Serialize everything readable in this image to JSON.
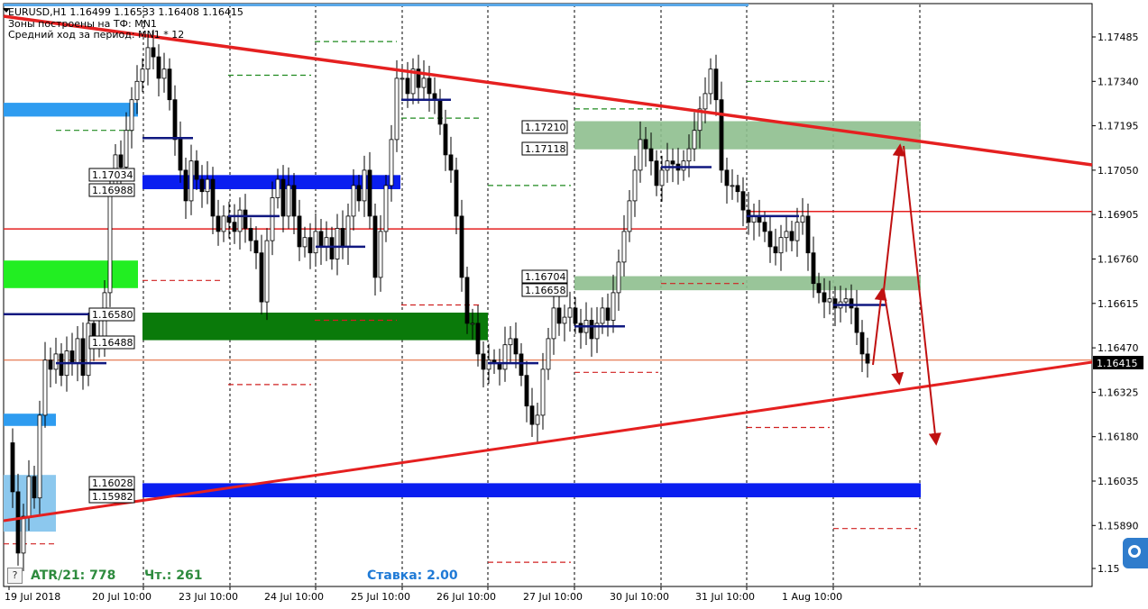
{
  "header": {
    "symbol_line": "EURUSD,H1  1.16499 1.16533 1.16408 1.16415",
    "zones_line": "Зоны построены на ТФ: MN1",
    "avg_line": "Средний ход за период: MN1 * 12"
  },
  "footer": {
    "atr": "ATR/21: 778",
    "count": "Чт.: 261",
    "rate": "Ставка: 2.00",
    "help": "?"
  },
  "colors": {
    "trendline": "#e52020",
    "level_blue": "#0a1ef0",
    "level_lightblue": "#2e9cf0",
    "zone_green_bright": "#22ee22",
    "zone_green_dark": "#0a7a0a",
    "zone_green_pale": "#8ebf8e",
    "pivot_navy": "#101880",
    "arrow": "#c01010"
  },
  "chart_data": {
    "type": "candlestick",
    "symbol": "EURUSD",
    "timeframe": "H1",
    "ohlc_last": {
      "open": 1.16499,
      "high": 1.16533,
      "low": 1.16408,
      "close": 1.16415
    },
    "current_price": "1.16415",
    "ylim": [
      1.1575,
      1.1762
    ],
    "y_ticks": [
      "1.17485",
      "1.17340",
      "1.17195",
      "1.17050",
      "1.16905",
      "1.16760",
      "1.16615",
      "1.16470",
      "1.16325",
      "1.16180",
      "1.16035",
      "1.15890",
      "1.15"
    ],
    "x_ticks": [
      "19 Jul 2018",
      "20 Jul 10:00",
      "23 Jul 10:00",
      "24 Jul 10:00",
      "25 Jul 10:00",
      "26 Jul 10:00",
      "27 Jul 10:00",
      "30 Jul 10:00",
      "31 Jul 10:00",
      "1 Aug 10:00"
    ],
    "zone_labels": [
      "1.17210",
      "1.17118",
      "1.17034",
      "1.16988",
      "1.16704",
      "1.16658",
      "1.16580",
      "1.16488",
      "1.16028",
      "1.15982"
    ],
    "horizontal_lines": [
      1.1686,
      1.1643
    ],
    "grid": "vertical dashed"
  }
}
